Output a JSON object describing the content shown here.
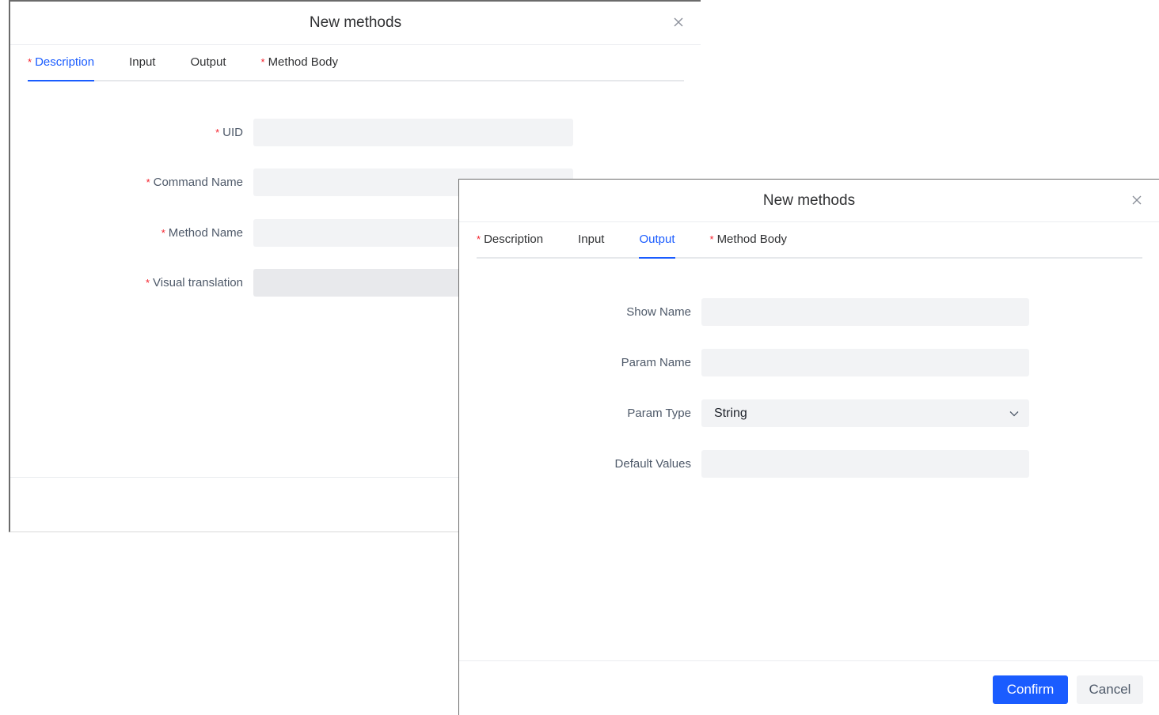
{
  "back_dialog": {
    "title": "New methods",
    "tabs": [
      {
        "label": "Description",
        "required": "*"
      },
      {
        "label": "Input",
        "required": ""
      },
      {
        "label": "Output",
        "required": ""
      },
      {
        "label": "Method Body",
        "required": "*"
      }
    ],
    "active_tab": "Description",
    "fields": [
      {
        "label": "UID",
        "required": "*",
        "value": ""
      },
      {
        "label": "Command Name",
        "required": "*",
        "value": ""
      },
      {
        "label": "Method Name",
        "required": "*",
        "value": ""
      },
      {
        "label": "Visual translation",
        "required": "*",
        "value": ""
      }
    ]
  },
  "front_dialog": {
    "title": "New methods",
    "tabs": [
      {
        "label": "Description",
        "required": "*"
      },
      {
        "label": "Input",
        "required": ""
      },
      {
        "label": "Output",
        "required": ""
      },
      {
        "label": "Method Body",
        "required": "*"
      }
    ],
    "active_tab": "Output",
    "fields": [
      {
        "label": "Show Name",
        "value": ""
      },
      {
        "label": "Param Name",
        "value": ""
      },
      {
        "label": "Param Type",
        "value": "String"
      },
      {
        "label": "Default Values",
        "value": ""
      }
    ],
    "buttons": {
      "confirm": "Confirm",
      "cancel": "Cancel"
    }
  },
  "icons": {
    "close": "close-icon",
    "dropdown": "chevron-down-icon"
  },
  "colors": {
    "accent": "#1a5cff",
    "required": "#f5222d",
    "input_bg": "#f2f3f5"
  }
}
